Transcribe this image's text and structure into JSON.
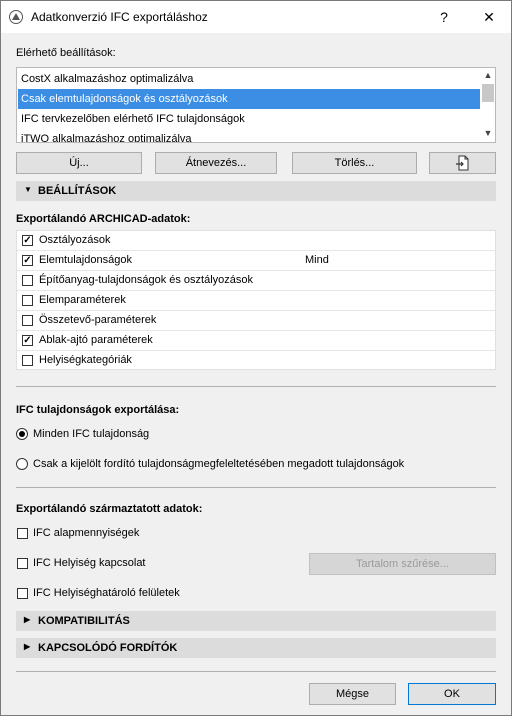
{
  "window": {
    "title": "Adatkonverzió IFC exportáláshoz",
    "help": "?",
    "close": "✕"
  },
  "presets": {
    "label": "Elérhető beállítások:",
    "items": [
      "CostX alkalmazáshoz optimalizálva",
      "Csak elemtulajdonságok és osztályozások",
      "IFC tervkezelőben elérhető IFC tulajdonságok",
      "iTWO alkalmazáshoz optimalizálva"
    ],
    "selected_index": 1
  },
  "preset_buttons": {
    "new": "Új...",
    "rename": "Átnevezés...",
    "delete": "Törlés..."
  },
  "settings_section": "BEÁLLÍTÁSOK",
  "archicad_data": {
    "label": "Exportálandó ARCHICAD-adatok:",
    "rows": [
      {
        "label": "Osztályozások",
        "checked": true,
        "value": ""
      },
      {
        "label": "Elemtulajdonságok",
        "checked": true,
        "value": "Mind"
      },
      {
        "label": "Építőanyag-tulajdonságok és osztályozások",
        "checked": false,
        "value": ""
      },
      {
        "label": "Elemparaméterek",
        "checked": false,
        "value": ""
      },
      {
        "label": "Összetevő-paraméterek",
        "checked": false,
        "value": ""
      },
      {
        "label": "Ablak-ajtó paraméterek",
        "checked": true,
        "value": ""
      },
      {
        "label": "Helyiségkategóriák",
        "checked": false,
        "value": ""
      }
    ]
  },
  "ifc_props": {
    "label": "IFC tulajdonságok exportálása:",
    "option_all": "Minden IFC tulajdonság",
    "option_mapped": "Csak a kijelölt fordító tulajdonságmegfeleltetésében megadott tulajdonságok",
    "selected": "all"
  },
  "derived": {
    "label": "Exportálandó származtatott adatok:",
    "base_quantities": "IFC alapmennyiségek",
    "space_containment": "IFC Helyiség kapcsolat",
    "filter_button": "Tartalom szűrése...",
    "space_boundaries": "IFC Helyiséghatároló felületek"
  },
  "compat_section": "KOMPATIBILITÁS",
  "translators_section": "KAPCSOLÓDÓ FORDÍTÓK",
  "footer": {
    "cancel": "Mégse",
    "ok": "OK"
  },
  "colors": {
    "selection": "#3c8ee4",
    "section_bar": "#dcdcdc"
  }
}
